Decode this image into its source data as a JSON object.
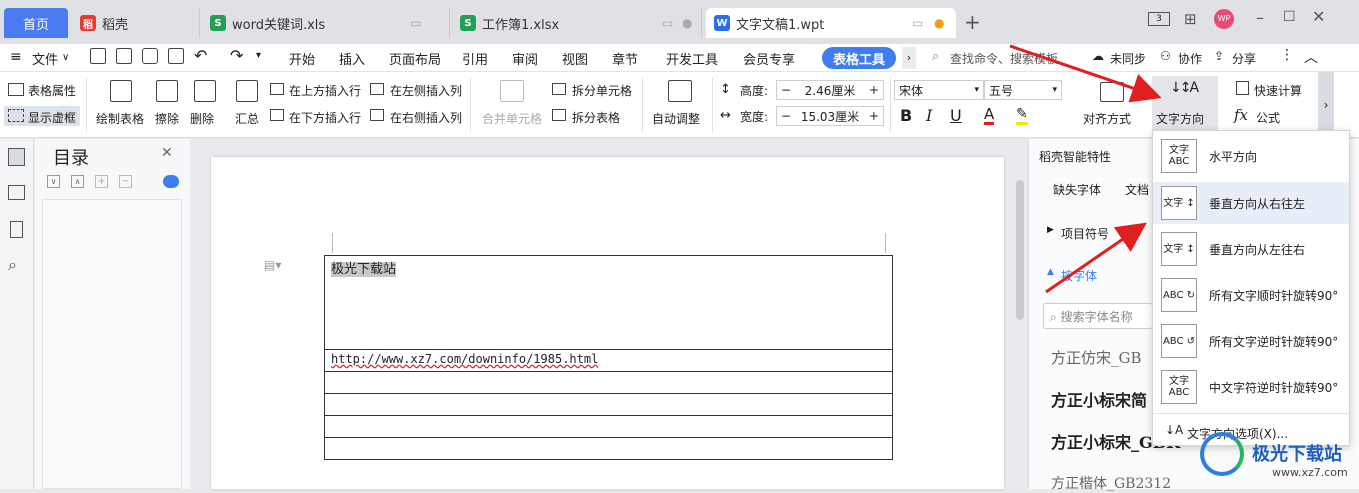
{
  "tabs": {
    "home": "首页",
    "tab1": "稻壳",
    "tab2": "word关键词.xls",
    "tab3": "工作簿1.xlsx",
    "tab4": "文字文稿1.wpt",
    "add": "+"
  },
  "window": {
    "user": "WP"
  },
  "menubar": {
    "file": "文件",
    "items": [
      "开始",
      "插入",
      "页面布局",
      "引用",
      "审阅",
      "视图",
      "章节",
      "开发工具",
      "会员专享"
    ],
    "table_tool": "表格工具",
    "search_placeholder": "查找命令、搜索模板",
    "sync": "未同步",
    "collab": "协作",
    "share": "分享"
  },
  "ribbon": {
    "table_props": "表格属性",
    "show_frame": "显示虚框",
    "draw_table": "绘制表格",
    "erase": "擦除",
    "delete": "删除",
    "summary": "汇总",
    "insert_above": "在上方插入行",
    "insert_below": "在下方插入行",
    "insert_left": "在左侧插入列",
    "insert_right": "在右侧插入列",
    "merge_cells": "合并单元格",
    "split_cells": "拆分单元格",
    "split_table": "拆分表格",
    "auto_adjust": "自动调整",
    "height_label": "高度:",
    "height_value": "2.46厘米",
    "width_label": "宽度:",
    "width_value": "15.03厘米",
    "font_name": "宋体",
    "font_size": "五号",
    "align": "对齐方式",
    "text_dir": "文字方向",
    "quick_calc": "快速计算",
    "formula": "公式"
  },
  "toc": {
    "title": "目录"
  },
  "document": {
    "cell1": "极光下载站",
    "cell2": "http://www.xz7.com/downinfo/1985.html"
  },
  "rpanel": {
    "title": "稻壳智能特性",
    "missing_font": "缺失字体",
    "doc_tab": "文档",
    "bullet": "项目符号",
    "font_section": "按字体",
    "search_placeholder": "搜索字体名称",
    "fonts": [
      "方正仿宋_GB",
      "方正小标宋简",
      "方正小标宋_GBK",
      "方正楷体_GB2312"
    ]
  },
  "dropdown": {
    "items": [
      {
        "icon": "文字 ABC",
        "label": "水平方向"
      },
      {
        "icon": "文字 ↕",
        "label": "垂直方向从右往左"
      },
      {
        "icon": "文字 ↕",
        "label": "垂直方向从左往右"
      },
      {
        "icon": "ABC ↻",
        "label": "所有文字顺时针旋转90°"
      },
      {
        "icon": "ABC ↺",
        "label": "所有文字逆时针旋转90°"
      },
      {
        "icon": "文字 ABC",
        "label": "中文字符逆时针旋转90°"
      }
    ],
    "options": "文字方向选项(X)..."
  },
  "watermark": {
    "text": "极光下载站",
    "url": "www.xz7.com"
  },
  "colors": {
    "accent": "#3f7cf0",
    "arrow": "#e02020"
  }
}
